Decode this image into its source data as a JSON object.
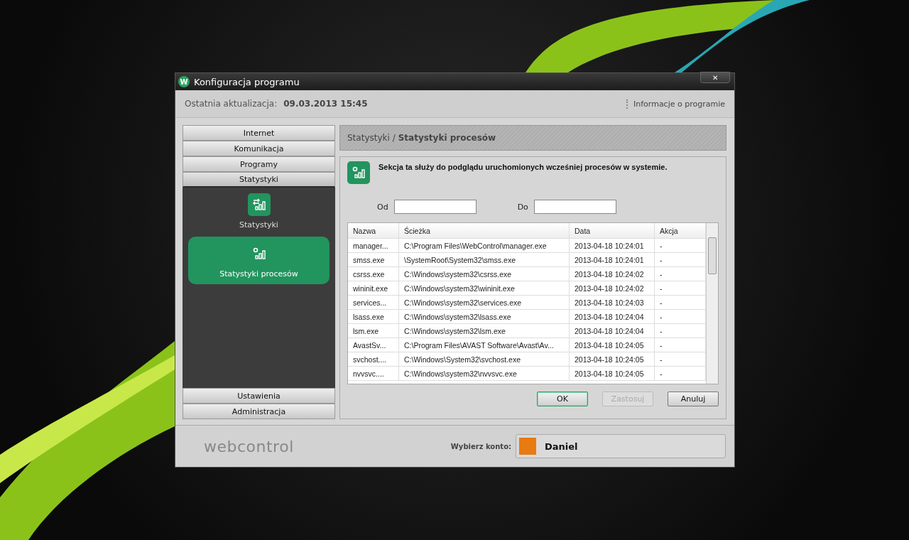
{
  "window": {
    "logo": "W",
    "title": "Konfiguracja programu",
    "close": "✕"
  },
  "header": {
    "label": "Ostatnia aktualizacja:",
    "value": "09.03.2013 15:45",
    "about": "Informacje o programie"
  },
  "sidebar": {
    "groups": [
      {
        "label": "Internet",
        "expanded": false
      },
      {
        "label": "Komunikacja",
        "expanded": false
      },
      {
        "label": "Programy",
        "expanded": false
      },
      {
        "label": "Statystyki",
        "expanded": true,
        "children": [
          {
            "label": "Statystyki",
            "kind": "transfer",
            "selected": false
          },
          {
            "label": "Statystyki procesów",
            "kind": "process",
            "selected": true
          }
        ]
      },
      {
        "label": "Ustawienia",
        "expanded": false
      },
      {
        "label": "Administracja",
        "expanded": false
      }
    ]
  },
  "breadcrumb": {
    "parent": "Statystyki /",
    "current": "Statystyki procesów"
  },
  "description": "Sekcja ta służy do podglądu uruchomionych wcześniej procesów w systemie.",
  "filters": [
    {
      "label": "Od"
    },
    {
      "label": "Do"
    }
  ],
  "table": {
    "columns": [
      "Nazwa",
      "Ścieżka",
      "Data",
      "Akcja"
    ],
    "rows": [
      [
        "manager...",
        "C:\\Program Files\\WebControl\\manager.exe",
        "2013-04-18 10:24:01",
        "-"
      ],
      [
        "smss.exe",
        "\\SystemRoot\\System32\\smss.exe",
        "2013-04-18 10:24:01",
        "-"
      ],
      [
        "csrss.exe",
        "C:\\Windows\\system32\\csrss.exe",
        "2013-04-18 10:24:02",
        "-"
      ],
      [
        "wininit.exe",
        "C:\\Windows\\system32\\wininit.exe",
        "2013-04-18 10:24:02",
        "-"
      ],
      [
        "services...",
        "C:\\Windows\\system32\\services.exe",
        "2013-04-18 10:24:03",
        "-"
      ],
      [
        "lsass.exe",
        "C:\\Windows\\system32\\lsass.exe",
        "2013-04-18 10:24:04",
        "-"
      ],
      [
        "lsm.exe",
        "C:\\Windows\\system32\\lsm.exe",
        "2013-04-18 10:24:04",
        "-"
      ],
      [
        "AvastSv...",
        "C:\\Program Files\\AVAST Software\\Avast\\Av...",
        "2013-04-18 10:24:05",
        "-"
      ],
      [
        "svchost....",
        "C:\\Windows\\System32\\svchost.exe",
        "2013-04-18 10:24:05",
        "-"
      ],
      [
        "nvvsvc....",
        "C:\\Windows\\system32\\nvvsvc.exe",
        "2013-04-18 10:24:05",
        "-"
      ]
    ]
  },
  "buttons": [
    {
      "label": "OK",
      "kind": "default",
      "disabled": false
    },
    {
      "label": "Zastosuj",
      "kind": "normal",
      "disabled": true
    },
    {
      "label": "Anuluj",
      "kind": "normal",
      "disabled": false
    }
  ],
  "footer": {
    "logo": "webcontrol",
    "account_label": "Wybierz konto:",
    "account": "Daniel"
  }
}
